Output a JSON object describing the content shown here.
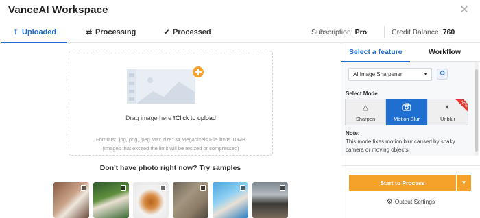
{
  "header": {
    "title": "VanceAI Workspace",
    "close_icon": "close-icon"
  },
  "tabs": [
    {
      "label": "Uploaded",
      "icon": "upload-icon",
      "active": true
    },
    {
      "label": "Processing",
      "icon": "sync-icon",
      "active": false
    },
    {
      "label": "Processed",
      "icon": "check-circle-icon",
      "active": false
    }
  ],
  "account": {
    "subscription_label": "Subscription:",
    "subscription_value": "Pro",
    "credit_label": "Credit Balance:",
    "credit_value": "760"
  },
  "upload": {
    "drag_text": "Drag image here",
    "click_text": "Click to upload",
    "formats": "Formats: .jpg,.png,.jpeg Max size: 34 Megapixels File limits 10MB",
    "note": "(Images that exceed the limit will be resized or compressed)"
  },
  "samples": {
    "title": "Don't have photo right now? Try samples",
    "items": [
      {
        "label": "sample-person-dress"
      },
      {
        "label": "sample-person-forest"
      },
      {
        "label": "sample-dog"
      },
      {
        "label": "sample-cat"
      },
      {
        "label": "sample-person-blue"
      },
      {
        "label": "sample-person-street"
      }
    ]
  },
  "feature_panel": {
    "tabs": [
      {
        "label": "Select a feature",
        "active": true
      },
      {
        "label": "Workflow",
        "active": false
      }
    ],
    "selected_feature": "AI Image Sharpener",
    "mode_label": "Select Mode",
    "modes": [
      {
        "label": "Sharpen",
        "icon": "sharpen-icon",
        "active": false
      },
      {
        "label": "Motion Blur",
        "icon": "camera-icon",
        "active": true
      },
      {
        "label": "Unblur",
        "icon": "unblur-icon",
        "active": false,
        "badge": "NEW"
      }
    ],
    "note_title": "Note:",
    "note_text": "This mode fixes motion blur caused by shaky camera or moving objects."
  },
  "actions": {
    "start_label": "Start to Process",
    "output_settings_label": "Output Settings"
  },
  "colors": {
    "accent": "#1f6fd1",
    "action": "#f5a22a",
    "badge": "#e23b2e"
  }
}
